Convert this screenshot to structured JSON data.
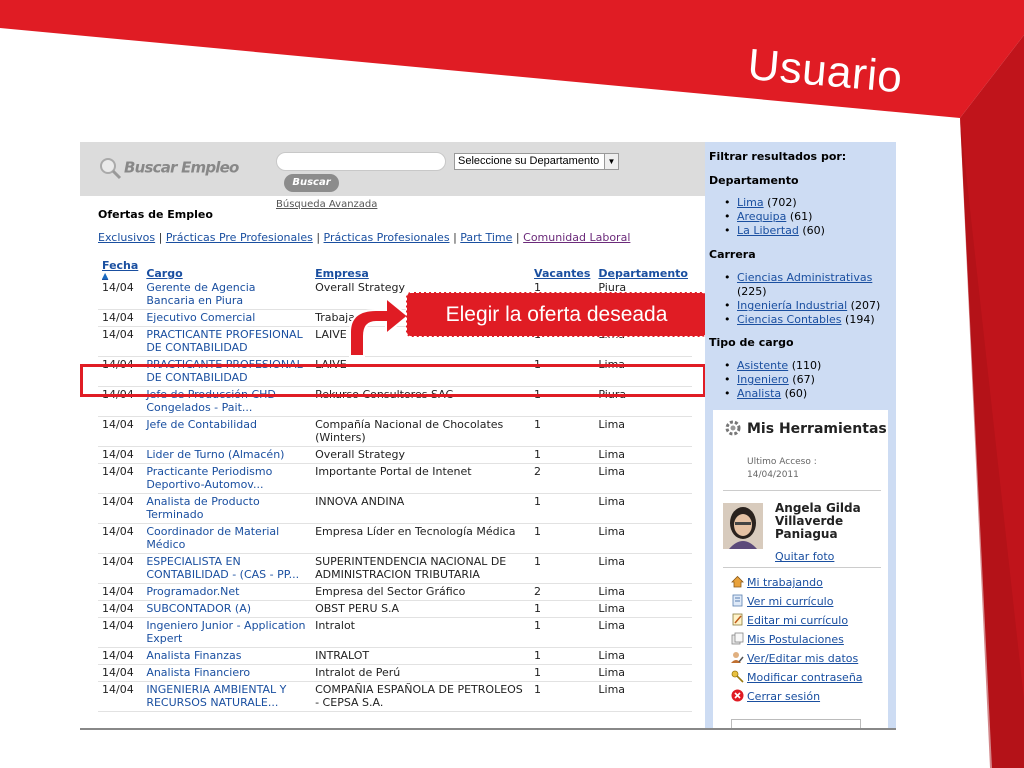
{
  "slide": {
    "title": "Usuario",
    "colors": {
      "accent": "#e01c24",
      "accent_dark": "#c0141b"
    }
  },
  "search": {
    "logo_text": "Buscar Empleo",
    "input_value": "",
    "department_select": "Seleccione su Departamento",
    "button_label": "Buscar",
    "advanced_link": "Búsqueda Avanzada"
  },
  "offers": {
    "title": "Ofertas de Empleo",
    "categories": [
      "Exclusivos",
      "Prácticas Pre Profesionales",
      "Prácticas Profesionales",
      "Part Time",
      "Comunidad Laboral"
    ],
    "separator": "|",
    "columns": [
      "Fecha",
      "Cargo",
      "Empresa",
      "Vacantes",
      "Departamento"
    ],
    "rows": [
      {
        "fecha": "14/04",
        "cargo": "Gerente de Agencia Bancaria en Piura",
        "empresa": "Overall Strategy",
        "vacantes": "1",
        "departamento": "Piura"
      },
      {
        "fecha": "14/04",
        "cargo": "Ejecutivo Comercial",
        "empresa": "Trabajando.com",
        "vacantes": "",
        "departamento": ""
      },
      {
        "fecha": "14/04",
        "cargo": "PRACTICANTE PROFESIONAL DE CONTABILIDAD",
        "empresa": "LAIVE",
        "vacantes": "1",
        "departamento": "Lima"
      },
      {
        "fecha": "14/04",
        "cargo": "PRACTICANTE PROFESIONAL DE CONTABILIDAD",
        "empresa": "LAIVE",
        "vacantes": "1",
        "departamento": "Lima"
      },
      {
        "fecha": "14/04",
        "cargo": "Jefe de Producción CHD Congelados - Pait...",
        "empresa": "Rekurso Consultores SAC",
        "vacantes": "1",
        "departamento": "Piura"
      },
      {
        "fecha": "14/04",
        "cargo": "Jefe de Contabilidad",
        "empresa": "Compañía Nacional de Chocolates (Winters)",
        "vacantes": "1",
        "departamento": "Lima"
      },
      {
        "fecha": "14/04",
        "cargo": "Lider de Turno (Almacén)",
        "empresa": "Overall Strategy",
        "vacantes": "1",
        "departamento": "Lima"
      },
      {
        "fecha": "14/04",
        "cargo": "Practicante Periodismo Deportivo-Automov...",
        "empresa": "Importante Portal de Intenet",
        "vacantes": "2",
        "departamento": "Lima"
      },
      {
        "fecha": "14/04",
        "cargo": "Analista de Producto Terminado",
        "empresa": "INNOVA ANDINA",
        "vacantes": "1",
        "departamento": "Lima"
      },
      {
        "fecha": "14/04",
        "cargo": "Coordinador de Material Médico",
        "empresa": "Empresa Líder en Tecnología Médica",
        "vacantes": "1",
        "departamento": "Lima"
      },
      {
        "fecha": "14/04",
        "cargo": "ESPECIALISTA EN CONTABILIDAD - (CAS - PP...",
        "empresa": "SUPERINTENDENCIA NACIONAL DE ADMINISTRACION TRIBUTARIA",
        "vacantes": "1",
        "departamento": "Lima"
      },
      {
        "fecha": "14/04",
        "cargo": "Programador.Net",
        "empresa": "Empresa del Sector Gráfico",
        "vacantes": "2",
        "departamento": "Lima"
      },
      {
        "fecha": "14/04",
        "cargo": "SUBCONTADOR (A)",
        "empresa": "OBST PERU S.A",
        "vacantes": "1",
        "departamento": "Lima"
      },
      {
        "fecha": "14/04",
        "cargo": "Ingeniero Junior - Application Expert",
        "empresa": "Intralot",
        "vacantes": "1",
        "departamento": "Lima"
      },
      {
        "fecha": "14/04",
        "cargo": "Analista Finanzas",
        "empresa": "INTRALOT",
        "vacantes": "1",
        "departamento": "Lima"
      },
      {
        "fecha": "14/04",
        "cargo": "Analista Financiero",
        "empresa": "Intralot de Perú",
        "vacantes": "1",
        "departamento": "Lima"
      },
      {
        "fecha": "14/04",
        "cargo": "INGENIERIA AMBIENTAL Y RECURSOS NATURALE...",
        "empresa": "COMPAÑIA ESPAÑOLA DE PETROLEOS - CEPSA S.A.",
        "vacantes": "1",
        "departamento": "Lima"
      }
    ]
  },
  "callout": {
    "text": "Elegir la oferta deseada"
  },
  "filters": {
    "title": "Filtrar resultados por:",
    "groups": [
      {
        "name": "Departamento",
        "items": [
          {
            "label": "Lima",
            "count": "(702)"
          },
          {
            "label": "Arequipa",
            "count": "(61)"
          },
          {
            "label": "La Libertad",
            "count": "(60)"
          }
        ]
      },
      {
        "name": "Carrera",
        "items": [
          {
            "label": "Ciencias Administrativas",
            "count": "(225)"
          },
          {
            "label": "Ingeniería Industrial",
            "count": "(207)"
          },
          {
            "label": "Ciencias Contables",
            "count": "(194)"
          }
        ]
      },
      {
        "name": "Tipo de cargo",
        "items": [
          {
            "label": "Asistente",
            "count": "(110)"
          },
          {
            "label": "Ingeniero",
            "count": "(67)"
          },
          {
            "label": "Analista",
            "count": "(60)"
          }
        ]
      }
    ]
  },
  "tools": {
    "title": "Mis Herramientas",
    "last_access_label": "Ultimo Acceso :",
    "last_access_date": "14/04/2011",
    "user_name": "Angela Gilda Villaverde Paniagua",
    "remove_photo": "Quitar foto",
    "links": [
      {
        "label": "Mi trabajando",
        "icon": "home-icon"
      },
      {
        "label": "Ver mi currículo",
        "icon": "document-icon"
      },
      {
        "label": "Editar mi currículo",
        "icon": "edit-document-icon"
      },
      {
        "label": "Mis Postulaciones",
        "icon": "documents-icon"
      },
      {
        "label": "Ver/Editar mis datos",
        "icon": "user-edit-icon"
      },
      {
        "label": "Modificar contraseña",
        "icon": "key-icon"
      },
      {
        "label": "Cerrar sesión",
        "icon": "logout-icon"
      }
    ]
  }
}
